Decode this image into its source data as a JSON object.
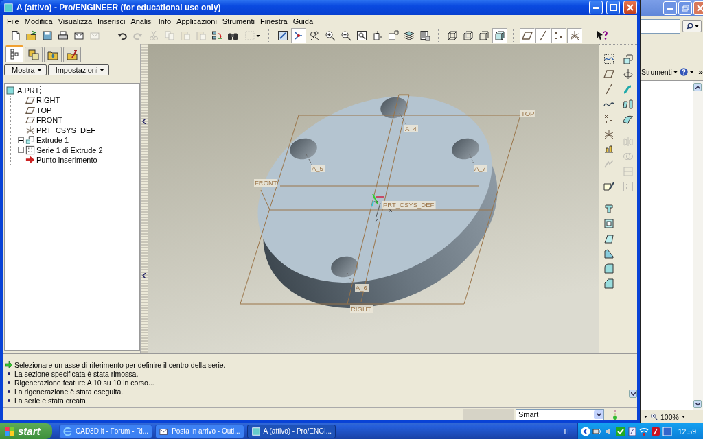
{
  "window": {
    "title": "A (attivo) - Pro/ENGINEER (for educational use only)"
  },
  "menu": [
    "File",
    "Modifica",
    "Visualizza",
    "Inserisci",
    "Analisi",
    "Info",
    "Applicazioni",
    "Strumenti",
    "Finestra",
    "Guida"
  ],
  "toolbar": {
    "groups": [
      {
        "items": [
          {
            "kind": "new",
            "pressed": false,
            "disabled": false
          },
          {
            "kind": "open",
            "pressed": false,
            "disabled": false
          },
          {
            "kind": "save",
            "pressed": false,
            "disabled": false
          },
          {
            "kind": "print",
            "pressed": false,
            "disabled": false
          },
          {
            "kind": "mail",
            "pressed": false,
            "disabled": false
          },
          {
            "kind": "mail",
            "pressed": false,
            "disabled": true
          }
        ]
      },
      {
        "items": [
          {
            "kind": "undo",
            "pressed": false,
            "disabled": false
          },
          {
            "kind": "redo",
            "pressed": false,
            "disabled": true
          },
          {
            "kind": "cut",
            "pressed": false,
            "disabled": true
          },
          {
            "kind": "copy",
            "pressed": false,
            "disabled": true
          },
          {
            "kind": "paste",
            "pressed": false,
            "disabled": true
          },
          {
            "kind": "paste",
            "pressed": false,
            "disabled": true
          },
          {
            "kind": "regenerate",
            "pressed": false,
            "disabled": false
          },
          {
            "kind": "find",
            "pressed": false,
            "disabled": false
          },
          {
            "kind": "select",
            "pressed": false,
            "disabled": true
          }
        ]
      },
      {
        "items": [
          {
            "kind": "repaint",
            "pressed": false,
            "disabled": false
          },
          {
            "kind": "spin",
            "pressed": true,
            "disabled": false
          },
          {
            "kind": "orient",
            "pressed": false,
            "disabled": false
          },
          {
            "kind": "zoomin",
            "pressed": false,
            "disabled": false
          },
          {
            "kind": "zoomout",
            "pressed": false,
            "disabled": false
          },
          {
            "kind": "refit",
            "pressed": false,
            "disabled": false
          },
          {
            "kind": "reorient",
            "pressed": false,
            "disabled": false
          },
          {
            "kind": "views",
            "pressed": false,
            "disabled": false
          },
          {
            "kind": "layers",
            "pressed": false,
            "disabled": false
          },
          {
            "kind": "setup",
            "pressed": false,
            "disabled": false
          }
        ]
      },
      {
        "items": [
          {
            "kind": "wireframe",
            "pressed": false,
            "disabled": false
          },
          {
            "kind": "hidden",
            "pressed": false,
            "disabled": false
          },
          {
            "kind": "nohidden",
            "pressed": false,
            "disabled": false
          },
          {
            "kind": "shaded",
            "pressed": true,
            "disabled": false
          }
        ]
      },
      {
        "items": [
          {
            "kind": "plane",
            "pressed": true,
            "disabled": false
          },
          {
            "kind": "axis",
            "pressed": true,
            "disabled": false
          },
          {
            "kind": "point",
            "pressed": true,
            "disabled": false
          },
          {
            "kind": "csys",
            "pressed": true,
            "disabled": false
          }
        ]
      },
      {
        "items": [
          {
            "kind": "help",
            "pressed": false,
            "disabled": false
          }
        ]
      }
    ]
  },
  "model_tree": {
    "tabs": [
      {
        "kind": "tree",
        "selected": true
      },
      {
        "kind": "layers",
        "selected": false
      },
      {
        "kind": "folder",
        "selected": false
      },
      {
        "kind": "favorites",
        "selected": false
      }
    ],
    "buttons": [
      "Mostra",
      "Impostazioni"
    ],
    "root": {
      "label": "A.PRT",
      "focused": true
    },
    "items": [
      {
        "kind": "plane",
        "label": "RIGHT",
        "collapsed": false
      },
      {
        "kind": "plane",
        "label": "TOP",
        "collapsed": false
      },
      {
        "kind": "plane",
        "label": "FRONT",
        "collapsed": false
      },
      {
        "kind": "csys",
        "label": "PRT_CSYS_DEF",
        "collapsed": false
      },
      {
        "kind": "extrude",
        "label": "Extrude 1",
        "collapsed": true
      },
      {
        "kind": "pattern",
        "label": "Serie 1 di Extrude 2",
        "collapsed": true
      },
      {
        "kind": "insert",
        "label": "Punto inserimento",
        "collapsed": false
      }
    ]
  },
  "canvas": {
    "labels": [
      {
        "kind": "plane",
        "text": "TOP"
      },
      {
        "kind": "plane",
        "text": "FRONT"
      },
      {
        "kind": "plane",
        "text": "RIGHT"
      },
      {
        "kind": "axis",
        "text": "A_4"
      },
      {
        "kind": "axis",
        "text": "A_5"
      },
      {
        "kind": "axis",
        "text": "A_7"
      },
      {
        "kind": "axis",
        "text": "A_6"
      },
      {
        "kind": "csys",
        "text": "PRT_CSYS_DEF"
      },
      {
        "kind": "triad",
        "text": "Y"
      },
      {
        "kind": "triad",
        "text": "X"
      },
      {
        "kind": "triad",
        "text": "Z"
      }
    ]
  },
  "feature_toolbar": {
    "columns": [
      {
        "groups": [
          {
            "items": [
              {
                "kind": "sketch",
                "disabled": false
              },
              {
                "kind": "plane",
                "disabled": false
              },
              {
                "kind": "axis",
                "disabled": false
              },
              {
                "kind": "curve",
                "disabled": false
              },
              {
                "kind": "point",
                "disabled": false
              },
              {
                "kind": "csys",
                "disabled": false
              },
              {
                "kind": "analysis",
                "disabled": false
              },
              {
                "kind": "import",
                "disabled": true
              }
            ]
          },
          {
            "items": [
              {
                "kind": "sketcher",
                "disabled": false
              }
            ]
          },
          {
            "items": [
              {
                "kind": "hole",
                "disabled": false
              },
              {
                "kind": "shell",
                "disabled": false
              },
              {
                "kind": "draft",
                "disabled": false
              },
              {
                "kind": "rib",
                "disabled": false
              },
              {
                "kind": "round",
                "disabled": false
              },
              {
                "kind": "chamfer",
                "disabled": false
              }
            ]
          }
        ]
      },
      {
        "groups": [
          {
            "items": [
              {
                "kind": "extrude",
                "disabled": false
              },
              {
                "kind": "revolve",
                "disabled": false
              },
              {
                "kind": "sweep",
                "disabled": false
              },
              {
                "kind": "blend",
                "disabled": false
              },
              {
                "kind": "style",
                "disabled": false
              }
            ]
          },
          {
            "items": [
              {
                "kind": "mirror",
                "disabled": true
              },
              {
                "kind": "merge",
                "disabled": true
              },
              {
                "kind": "trim",
                "disabled": true
              },
              {
                "kind": "pattern",
                "disabled": true
              }
            ]
          }
        ]
      }
    ]
  },
  "messages": [
    {
      "kind": "prompt",
      "text": "Selezionare un asse di riferimento per definire il centro della serie."
    },
    {
      "kind": "info",
      "text": "La sezione specificata è stata rimossa."
    },
    {
      "kind": "info",
      "text": "Rigenerazione feature A 10 su 10 in corso..."
    },
    {
      "kind": "info",
      "text": "La rigenerazione è stata eseguita."
    },
    {
      "kind": "info",
      "text": "La serie e stata creata."
    }
  ],
  "status_bar": {
    "filter": "Smart"
  },
  "background_window": {
    "menu": "Strumenti",
    "overflow": "»",
    "zoom": "100%"
  },
  "taskbar": {
    "start": "start",
    "tasks": [
      {
        "kind": "browser",
        "label": "CAD3D.it - Forum - Ri...",
        "selected": false
      },
      {
        "kind": "mail",
        "label": "Posta in arrivo - Outl...",
        "selected": false
      },
      {
        "kind": "app",
        "label": "A (attivo) - Pro/ENGI...",
        "selected": true
      }
    ],
    "language": "IT",
    "clock": "12.59"
  }
}
